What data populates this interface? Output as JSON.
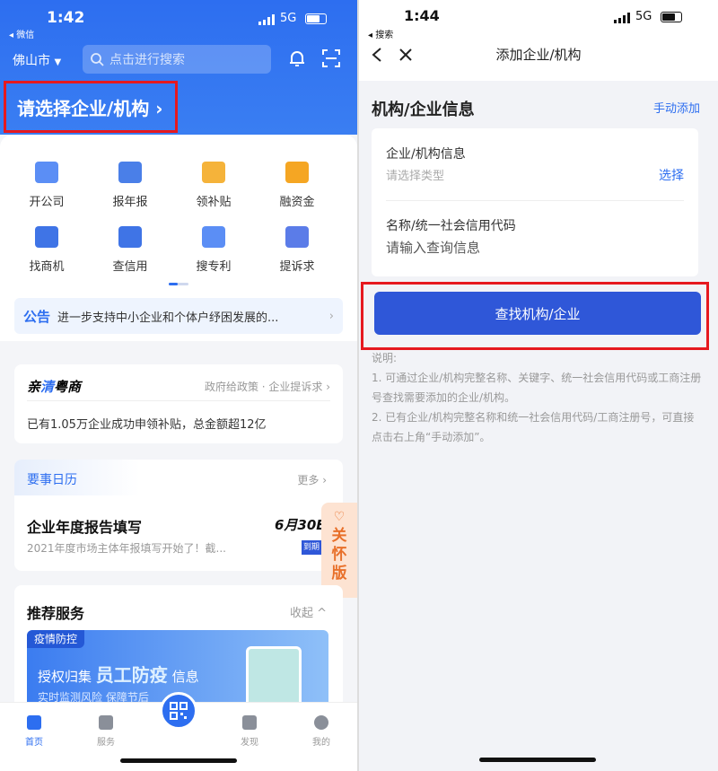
{
  "left": {
    "status": {
      "time": "1:42",
      "back": "◂ 微信",
      "net": "5G"
    },
    "header": {
      "city": "佛山市",
      "search_placeholder": "点击进行搜索",
      "pick_label": "请选择企业/机构 ›"
    },
    "services": [
      {
        "label": "开公司",
        "icon": "company-icon",
        "color": "#5b8ef5"
      },
      {
        "label": "报年报",
        "icon": "report-icon",
        "color": "#4a7fe8"
      },
      {
        "label": "领补贴",
        "icon": "subsidy-icon",
        "color": "#f5b33a"
      },
      {
        "label": "融资金",
        "icon": "finance-icon",
        "color": "#f5a623"
      },
      {
        "label": "找商机",
        "icon": "briefcase-icon",
        "color": "#3f74e6"
      },
      {
        "label": "查信用",
        "icon": "credit-icon",
        "color": "#3f74e6"
      },
      {
        "label": "搜专利",
        "icon": "patent-icon",
        "color": "#5b8ef5"
      },
      {
        "label": "提诉求",
        "icon": "appeal-icon",
        "color": "#5b7ce8"
      }
    ],
    "notice": {
      "tag": "公告",
      "text": "进一步支持中小企业和个体户纾困发展的..."
    },
    "policy": {
      "brand_a": "亲",
      "brand_b": "清",
      "brand_c": "粤商",
      "links": "政府给政策 · 企业提诉求 ›",
      "stat": "已有1.05万企业成功申领补贴，总金额超12亿"
    },
    "calendar": {
      "title": "要事日历",
      "more": "更多 ›",
      "item_title": "企业年度报告填写",
      "item_date": "6月30E",
      "item_desc": "2021年度市场主体年报填写开始了！截...",
      "badge": "到期"
    },
    "care": {
      "label_1": "关",
      "label_2": "怀",
      "label_3": "版"
    },
    "recommend": {
      "title": "推荐服务",
      "collapse": "收起 ^",
      "banner_tag": "疫情防控",
      "banner_pre": "授权归集",
      "banner_main": "员工防疫",
      "banner_post": "信息",
      "banner_sub": "实时监测风险 保障节后"
    },
    "tabs": [
      {
        "label": "首页"
      },
      {
        "label": "服务"
      },
      {
        "label": "发现"
      },
      {
        "label": "我的"
      }
    ]
  },
  "right": {
    "status": {
      "time": "1:44",
      "back": "◂ 搜索",
      "net": "5G"
    },
    "nav": {
      "title": "添加企业/机构"
    },
    "section": {
      "title": "机构/企业信息",
      "manual": "手动添加"
    },
    "form": {
      "type_label": "企业/机构信息",
      "type_placeholder": "请选择类型",
      "type_action": "选择",
      "name_label": "名称/统一社会信用代码",
      "name_placeholder": "请输入查询信息"
    },
    "find_button": "查找机构/企业",
    "notes": {
      "title": "说明:",
      "line1": "1. 可通过企业/机构完整名称、关键字、统一社会信用代码或工商注册号查找需要添加的企业/机构。",
      "line2": "2. 已有企业/机构完整名称和统一社会信用代码/工商注册号，可直接点击右上角“手动添加”。"
    }
  },
  "colors": {
    "primary": "#2d6ef0",
    "button": "#2f57d8",
    "highlight": "#e6191f",
    "care": "#e8702a"
  }
}
